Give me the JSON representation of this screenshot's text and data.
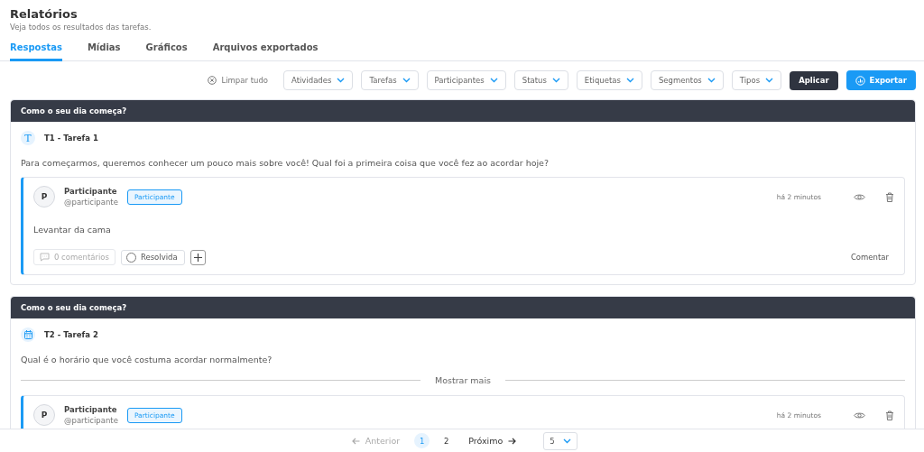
{
  "header": {
    "title": "Relatórios",
    "subtitle": "Veja todos os resultados das tarefas."
  },
  "tabs": [
    {
      "label": "Respostas",
      "selected": true
    },
    {
      "label": "Mídias",
      "selected": false
    },
    {
      "label": "Gráficos",
      "selected": false
    },
    {
      "label": "Arquivos exportados",
      "selected": false
    }
  ],
  "filters": {
    "clear": "Limpar tudo",
    "dropdowns": [
      "Atividades",
      "Tarefas",
      "Participantes",
      "Status",
      "Etiquetas",
      "Segmentos",
      "Tipos"
    ],
    "apply": "Aplicar",
    "export": "Exportar"
  },
  "sections": [
    {
      "title": "Como o seu dia começa?",
      "task": {
        "kind": "text",
        "icon": "T",
        "label": "T1 - Tarefa 1"
      },
      "question": "Para começarmos, queremos conhecer um pouco mais sobre você! Qual foi a primeira coisa que você fez ao acordar hoje?",
      "answers": [
        {
          "avatar": "P",
          "name": "Participante",
          "handle": "@participante",
          "badge": "Participante",
          "time": "há 2 minutos",
          "text": "Levantar da cama",
          "comments": "0 comentários",
          "resolved": false,
          "resolved_label": "Resolvida",
          "comment_link": "Comentar"
        }
      ]
    },
    {
      "title": "Como o seu dia começa?",
      "task": {
        "kind": "calendar",
        "label": "T2 - Tarefa 2"
      },
      "question": "Qual é o horário que você costuma acordar normalmente?",
      "show_more": "Mostrar mais",
      "answers": [
        {
          "avatar": "P",
          "name": "Participante",
          "handle": "@participante",
          "badge": "Participante",
          "time": "há 2 minutos"
        }
      ]
    }
  ],
  "pagination": {
    "previous": "Anterior",
    "pages": [
      {
        "label": "1",
        "selected": true
      },
      {
        "label": "2",
        "selected": false
      }
    ],
    "next": "Próximo",
    "page_size": "5"
  }
}
